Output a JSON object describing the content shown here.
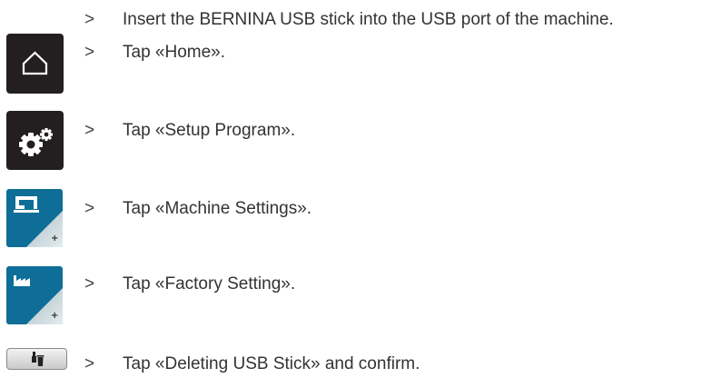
{
  "steps": [
    {
      "marker": ">",
      "text": "Insert the BERNINA USB stick into the USB port of the machine.",
      "icon": null
    },
    {
      "marker": ">",
      "text": "Tap «Home».",
      "icon": "home-icon"
    },
    {
      "marker": ">",
      "text": "Tap «Setup Program».",
      "icon": "gears-icon"
    },
    {
      "marker": ">",
      "text": "Tap «Machine Settings».",
      "icon": "sewing-machine-icon"
    },
    {
      "marker": ">",
      "text": "Tap «Factory Setting».",
      "icon": "factory-icon"
    },
    {
      "marker": ">",
      "text": "Tap «Deleting USB Stick» and confirm.",
      "icon": "delete-usb-icon"
    }
  ],
  "colors": {
    "text": "#333333",
    "dark_button": "#231f20",
    "blue_button": "#0e6e97",
    "grey_button": "#d9d9d9"
  }
}
